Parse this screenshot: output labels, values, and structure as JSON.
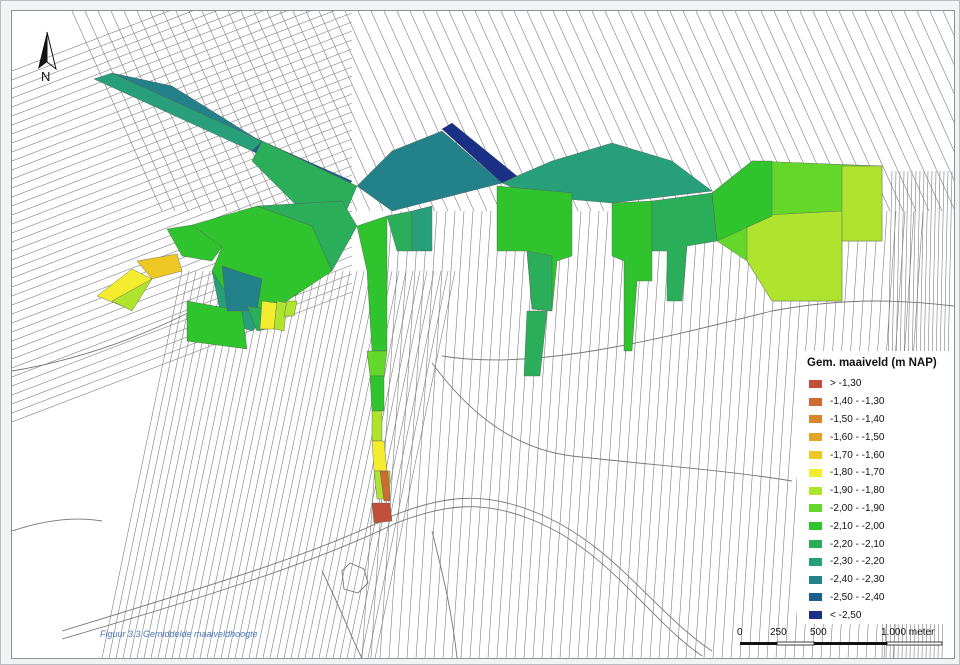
{
  "caption": "Figuur 3.3 Gemiddelde maaiveldhoogte",
  "north_arrow": {
    "icon": "north-arrow-icon",
    "label": "N"
  },
  "legend": {
    "title": "Gem. maaiveld (m NAP)",
    "classes": [
      {
        "label": "> -1,30",
        "color": "#c1503a"
      },
      {
        "label": "-1,40 - -1,30",
        "color": "#cf6a34"
      },
      {
        "label": "-1,50 - -1,40",
        "color": "#d9852b"
      },
      {
        "label": "-1,60 - -1,50",
        "color": "#e4a526"
      },
      {
        "label": "-1,70 - -1,60",
        "color": "#edc724"
      },
      {
        "label": "-1,80 - -1,70",
        "color": "#f4ec2f"
      },
      {
        "label": "-1,90 - -1,80",
        "color": "#aee32e"
      },
      {
        "label": "-2,00 - -1,90",
        "color": "#63d72a"
      },
      {
        "label": "-2,10 - -2,00",
        "color": "#2fc42d"
      },
      {
        "label": "-2,20 - -2,10",
        "color": "#2aae5a"
      },
      {
        "label": "-2,30 - -2,20",
        "color": "#27a07a"
      },
      {
        "label": "-2,40 - -2,30",
        "color": "#23818a"
      },
      {
        "label": "-2,50 - -2,40",
        "color": "#1f5f8c"
      },
      {
        "label": "< -2,50",
        "color": "#1a2f86"
      }
    ]
  },
  "scale_bar": {
    "labels": [
      "0",
      "250",
      "500",
      "1.000 meter"
    ]
  }
}
